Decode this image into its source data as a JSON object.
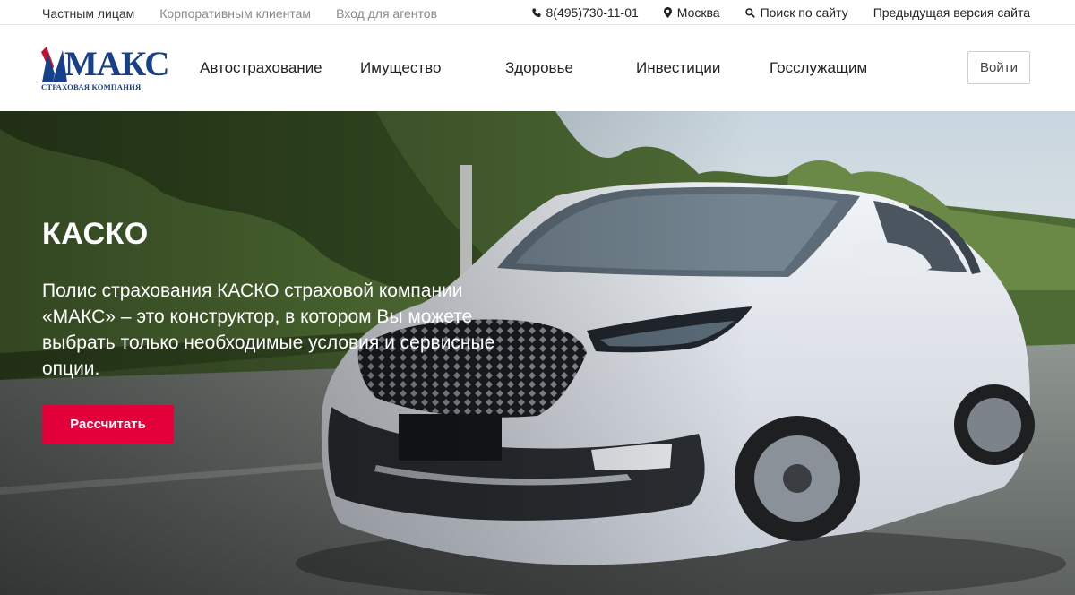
{
  "topbar": {
    "segments": [
      "Частным лицам",
      "Корпоративным клиентам",
      "Вход для агентов"
    ],
    "phone": "8(495)730-11-01",
    "city": "Москва",
    "search": "Поиск по сайту",
    "old_version": "Предыдущая версия сайта"
  },
  "logo": {
    "name": "МАКС",
    "subtitle": "СТРАХОВАЯ КОМПАНИЯ"
  },
  "nav": {
    "items": [
      "Автострахование",
      "Имущество",
      "Здоровье",
      "Инвестиции",
      "Госслужащим"
    ]
  },
  "header": {
    "login_label": "Войти"
  },
  "hero": {
    "title": "КАСКО",
    "text": "Полис страхования КАСКО страховой компании «МАКС» – это конструктор, в котором Вы можете выбрать только необходимые условия и сервисные опции.",
    "cta_label": "Рассчитать"
  },
  "colors": {
    "brand_blue": "#173f8a",
    "brand_red": "#e4003a",
    "accent_logo_red": "#c8102e"
  },
  "icons": {
    "phone": "phone-icon",
    "city": "location-pin-icon",
    "search": "search-icon"
  }
}
